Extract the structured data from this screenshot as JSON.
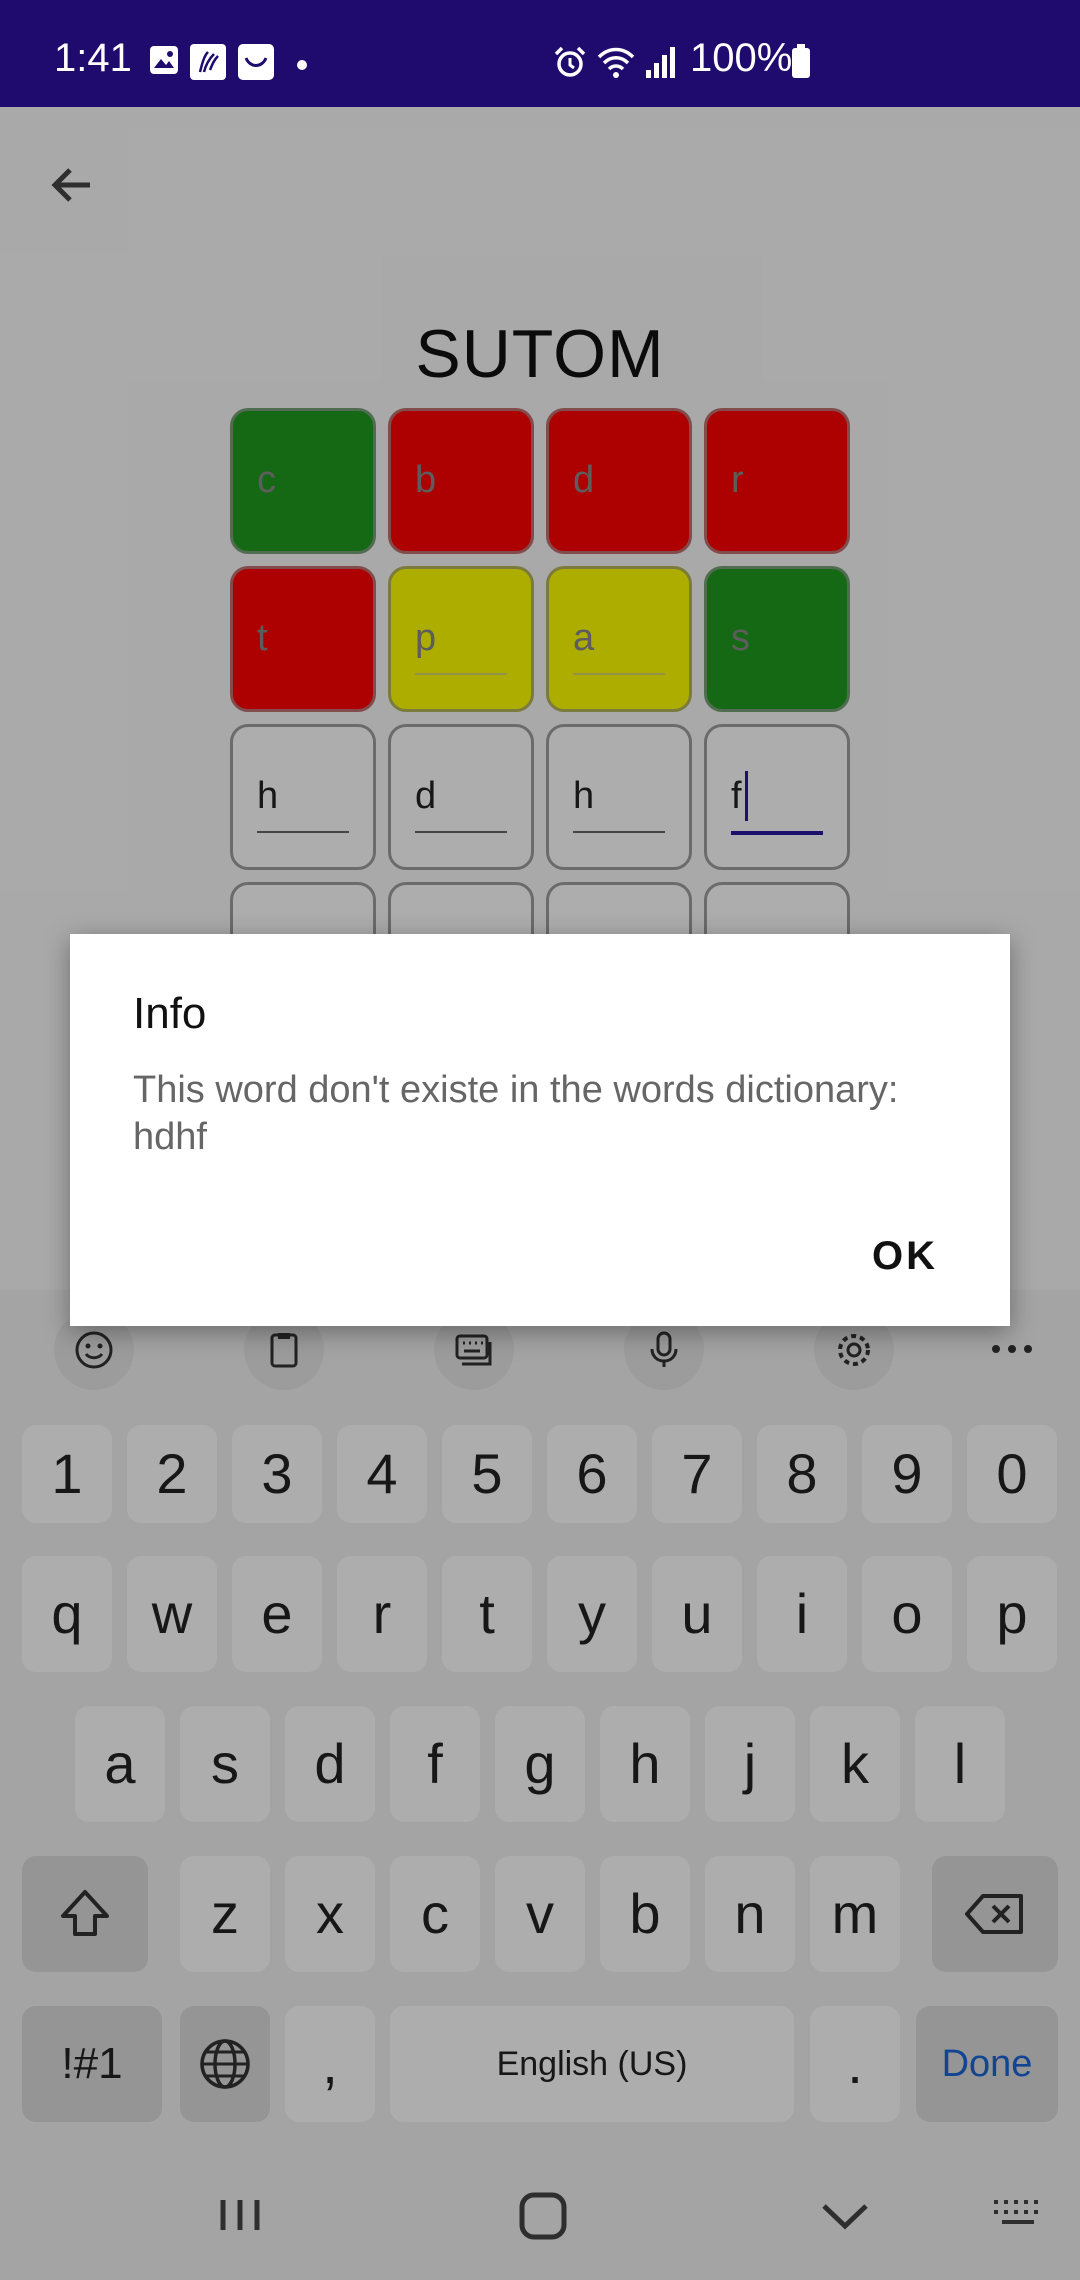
{
  "status_bar": {
    "time": "1:41",
    "battery": "100%",
    "icons": [
      "gallery-icon",
      "app-icon",
      "app-icon-2",
      "dot-icon",
      "alarm-icon",
      "wifi-icon",
      "signal-icon",
      "battery-icon"
    ]
  },
  "app": {
    "title": "SUTOM",
    "back_icon": "arrow-left-icon",
    "rows": [
      [
        {
          "letter": "c",
          "state": "green"
        },
        {
          "letter": "b",
          "state": "red"
        },
        {
          "letter": "d",
          "state": "red"
        },
        {
          "letter": "r",
          "state": "red"
        }
      ],
      [
        {
          "letter": "t",
          "state": "red"
        },
        {
          "letter": "p",
          "state": "yellow"
        },
        {
          "letter": "a",
          "state": "yellow"
        },
        {
          "letter": "s",
          "state": "green"
        }
      ],
      [
        {
          "letter": "h",
          "state": "input"
        },
        {
          "letter": "d",
          "state": "input"
        },
        {
          "letter": "h",
          "state": "input"
        },
        {
          "letter": "f",
          "state": "active"
        }
      ],
      [
        {
          "letter": "",
          "state": "empty"
        },
        {
          "letter": "",
          "state": "empty"
        },
        {
          "letter": "",
          "state": "empty"
        },
        {
          "letter": "",
          "state": "empty"
        }
      ]
    ],
    "colors": {
      "green": "#1f9b1f",
      "red": "#ff0000",
      "yellow": "#ffff00",
      "accent": "#2a18a0",
      "status_bar": "#1f0a6e"
    }
  },
  "dialog": {
    "title": "Info",
    "message": "This word don't existe in the words dictionary: hdhf",
    "ok_label": "OK"
  },
  "keyboard": {
    "toolbar_icons": [
      "emoji-icon",
      "clipboard-icon",
      "keyboard-mode-icon",
      "microphone-icon",
      "settings-icon",
      "more-icon"
    ],
    "row_numbers": [
      "1",
      "2",
      "3",
      "4",
      "5",
      "6",
      "7",
      "8",
      "9",
      "0"
    ],
    "row_1": [
      "q",
      "w",
      "e",
      "r",
      "t",
      "y",
      "u",
      "i",
      "o",
      "p"
    ],
    "row_2": [
      "a",
      "s",
      "d",
      "f",
      "g",
      "h",
      "j",
      "k",
      "l"
    ],
    "row_3": [
      "z",
      "x",
      "c",
      "v",
      "b",
      "n",
      "m"
    ],
    "symbols_label": "!#1",
    "comma_label": ",",
    "space_label": "English (US)",
    "period_label": ".",
    "done_label": "Done"
  },
  "nav_bar": {
    "icons": [
      "recents-icon",
      "home-icon",
      "back-icon",
      "keyboard-hide-icon"
    ]
  }
}
